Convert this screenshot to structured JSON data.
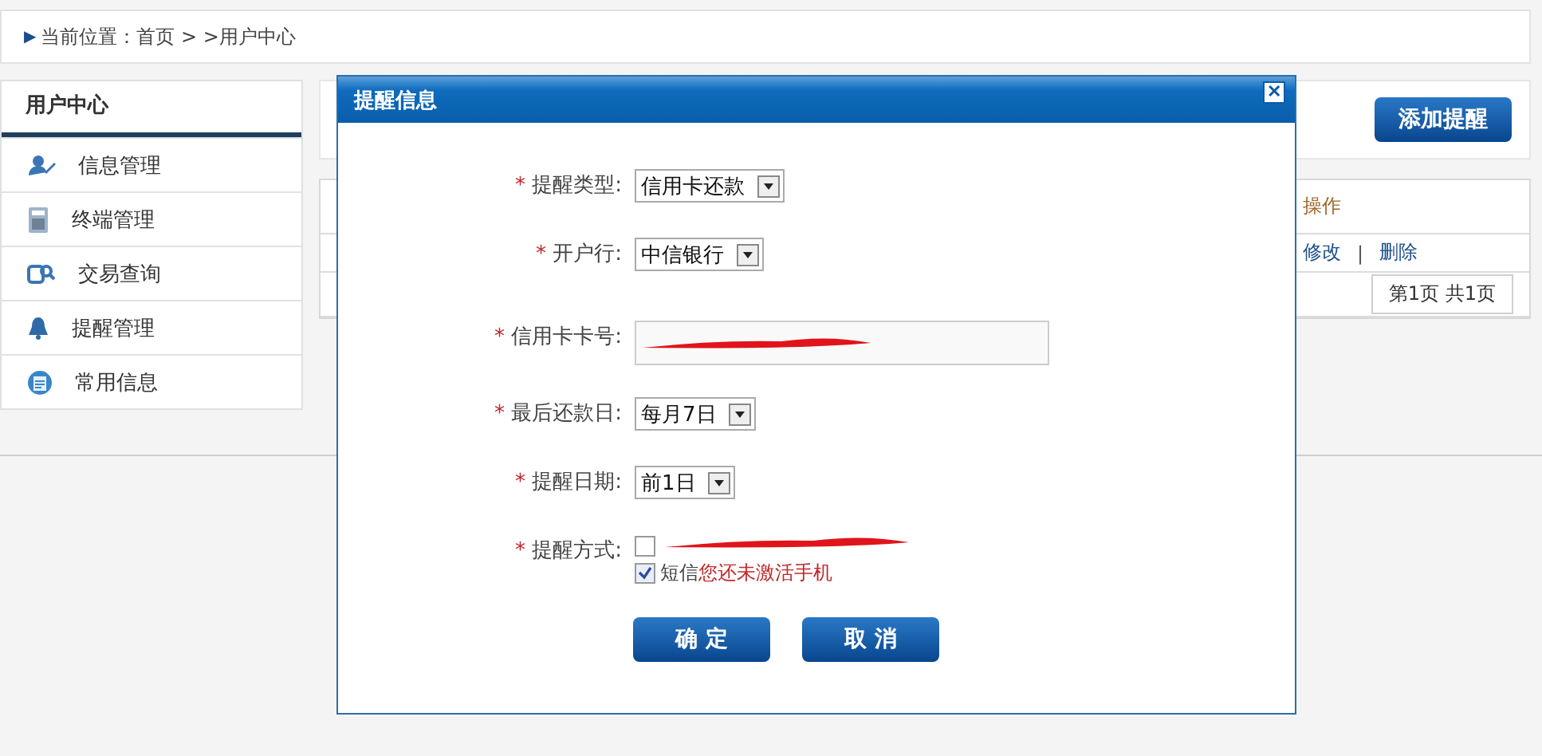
{
  "breadcrumb": {
    "marker": "▶",
    "text": "当前位置：首页 > >用户中心"
  },
  "sidebar": {
    "title": "用户中心",
    "items": [
      {
        "label": "信息管理"
      },
      {
        "label": "终端管理"
      },
      {
        "label": "交易查询"
      },
      {
        "label": "提醒管理"
      },
      {
        "label": "常用信息"
      }
    ]
  },
  "toolbar": {
    "add_button": "添加提醒"
  },
  "table": {
    "columns": [
      "操作"
    ],
    "rows": [
      {
        "actions": [
          "修改",
          "删除"
        ],
        "separator": "|"
      }
    ],
    "pager": "第1页 共1页"
  },
  "dialog": {
    "title": "提醒信息",
    "close": "✕",
    "fields": [
      {
        "kind": "select",
        "mark": "*",
        "label": "提醒类型:",
        "value": "信用卡还款"
      },
      {
        "kind": "select",
        "mark": "*",
        "label": "开户行:",
        "value": "中信银行"
      },
      {
        "kind": "text",
        "mark": "*",
        "label": "信用卡卡号:",
        "redacted": true
      },
      {
        "kind": "select",
        "mark": "*",
        "label": "最后还款日:",
        "value": "每月7日"
      },
      {
        "kind": "select",
        "mark": "*",
        "label": "提醒日期:",
        "value": "前1日"
      },
      {
        "kind": "checks",
        "mark": "*",
        "label": "提醒方式:",
        "options": [
          {
            "checked": false,
            "redacted": true
          },
          {
            "checked": true,
            "label": "短信",
            "warning": "您还未激活手机"
          }
        ]
      }
    ],
    "buttons": [
      "确 定",
      "取 消"
    ]
  }
}
